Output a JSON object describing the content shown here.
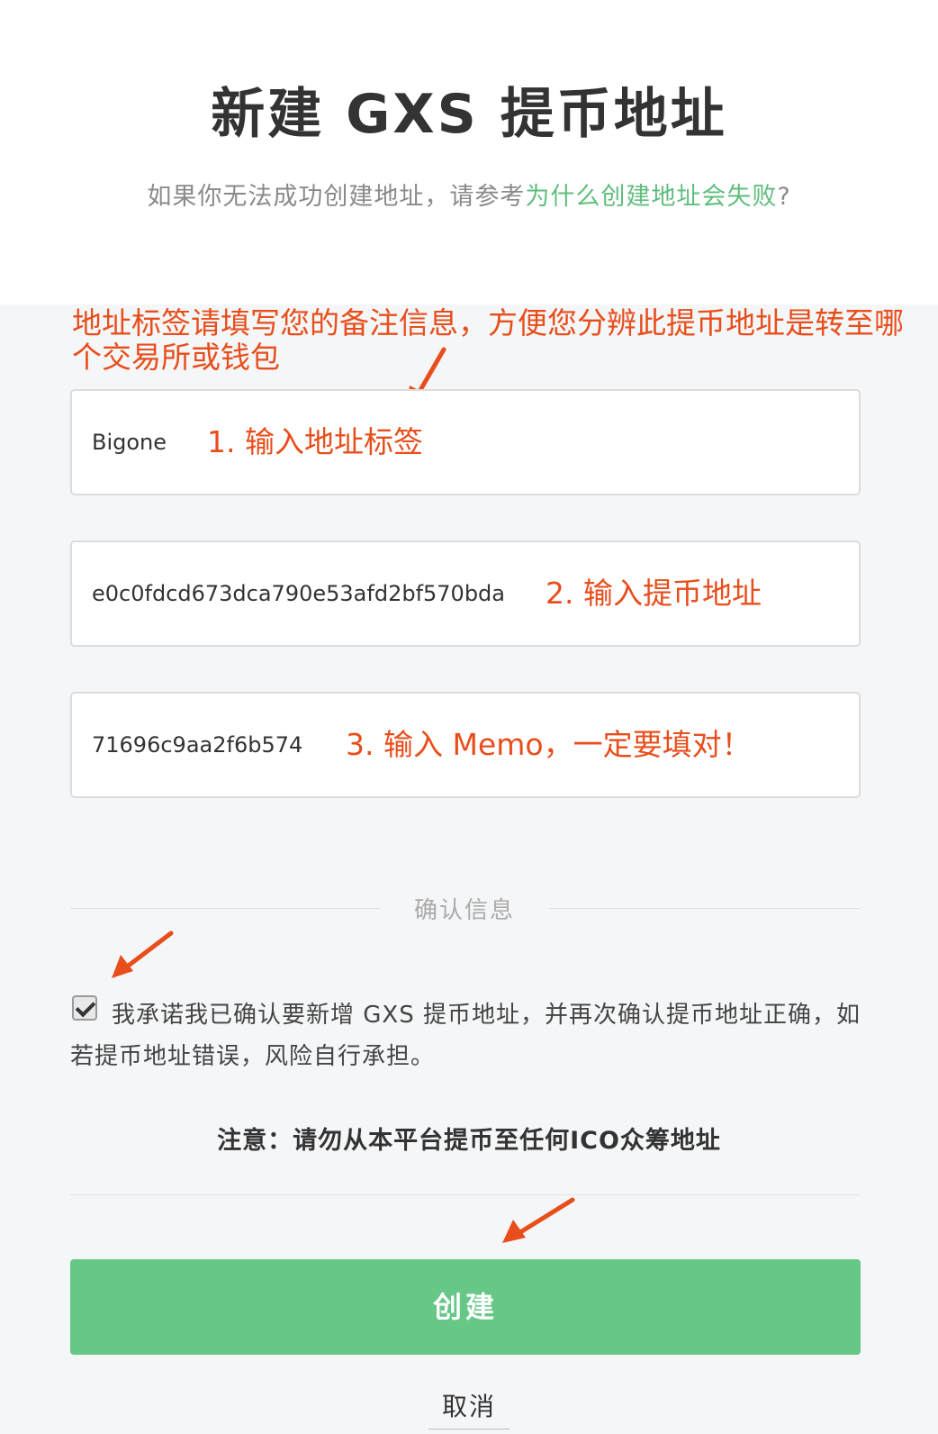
{
  "header": {
    "title": "新建 GXS 提币地址",
    "subtitle_prefix": "如果你无法成功创建地址，请参考",
    "subtitle_link": "为什么创建地址会失败",
    "subtitle_suffix": "?"
  },
  "annotation": {
    "top_note": "地址标签请填写您的备注信息，方便您分辨此提币地址是转至哪个交易所或钱包",
    "step1": "1. 输入地址标签",
    "step2": "2. 输入提币地址",
    "step3": "3. 输入 Memo，一定要填对！"
  },
  "form": {
    "label_value": "Bigone",
    "address_value": "e0c0fdcd673dca790e53afd2bf570bda",
    "memo_value": "71696c9aa2f6b574"
  },
  "confirm": {
    "section_label": "确认信息",
    "checkbox_checked": true,
    "agree_text": "我承诺我已确认要新增 GXS 提币地址，并再次确认提币地址正确，如若提币地址错误，风险自行承担。"
  },
  "warning": "注意：请勿从本平台提币至任何ICO众筹地址",
  "actions": {
    "create_label": "创建",
    "cancel_label": "取消"
  },
  "colors": {
    "accent_green": "#67c787",
    "link_green": "#5fbe7e",
    "annotation_red": "#e84e1c"
  }
}
